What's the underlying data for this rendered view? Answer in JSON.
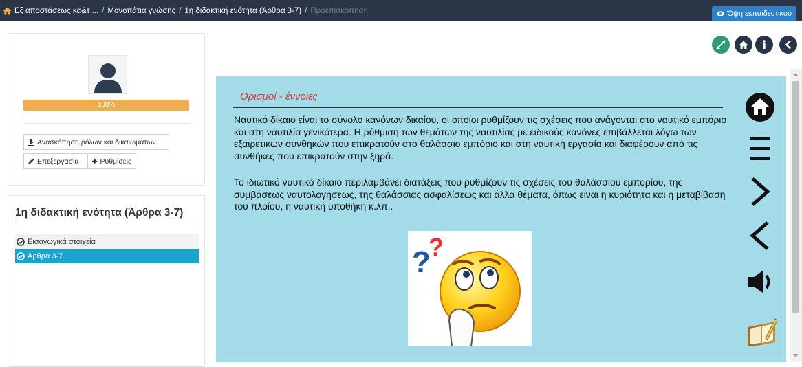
{
  "breadcrumb": {
    "items": [
      {
        "label": "Εξ αποστάσεως κα&τ ..."
      },
      {
        "label": "Μονοπάτια γνώσης"
      },
      {
        "label": "1η διδακτική ενότητα (Άρθρα 3-7)"
      },
      {
        "label": "Προεπισκόπηση"
      }
    ],
    "separator": "/"
  },
  "header": {
    "teacher_view_label": "Όψη εκπαιδευτικού"
  },
  "profile": {
    "progress_label": "100%",
    "progress_value": 100,
    "review_button": "Ανασκόπηση ρόλων και δικαιωμάτων",
    "edit_button": "Επεξεργασία",
    "settings_button": "Ρυθμίσεις"
  },
  "unit": {
    "title": "1η διδακτική ενότητα (Άρθρα 3-7)",
    "lessons": [
      {
        "label": "Εισαγωγικά στοιχεία",
        "active": false
      },
      {
        "label": "Άρθρα 3-7",
        "active": true
      }
    ]
  },
  "toolbar": {
    "icons": [
      "expand-icon",
      "home-icon",
      "info-icon",
      "back-icon"
    ]
  },
  "content": {
    "section_title": "Ορισμοί - έννοιες",
    "paragraphs": [
      "Ναυτικό δίκαιο είναι το σύνολο κανόνων δικαίου, οι οποίοι ρυθμίζουν τις σχέσεις που ανάγονται στο ναυτικό εμπόριο και στη ναυτιλία γενικότερα. Η ρύθμιση των θεμάτων της ναυτιλίας με ειδικούς κανόνες επιβάλλεται λόγω των εξαιρετικών συνθηκών που επικρατούν στο θαλάσσιο εμπόριο και στη ναυτική εργασία και διαφέρουν από τις συνθήκες που επικρατούν στην ξηρά.",
      "Το ιδιωτικό ναυτικό δίκαιο περιλαμβάνει διατάξεις που ρυθμίζουν τις σχέσεις του θαλάσσιου εμπορίου, της συμβάσεως ναυτολογήσεως, της θαλάσσιας ασφαλίσεως και άλλα θέματα, όπως είναι η κυριότητα και η μεταβίβαση του πλοίου, η ναυτική υποθήκη κ.λπ.."
    ],
    "nav_icons": [
      "home-icon",
      "menu-icon",
      "next-icon",
      "previous-icon",
      "speaker-icon",
      "notebook-icon"
    ]
  },
  "colors": {
    "topbar": "#2b3546",
    "content_bg": "#a3dbe8",
    "progress": "#f0ad4e",
    "active_lesson": "#1ba5cc",
    "section_title": "#e8322f"
  }
}
